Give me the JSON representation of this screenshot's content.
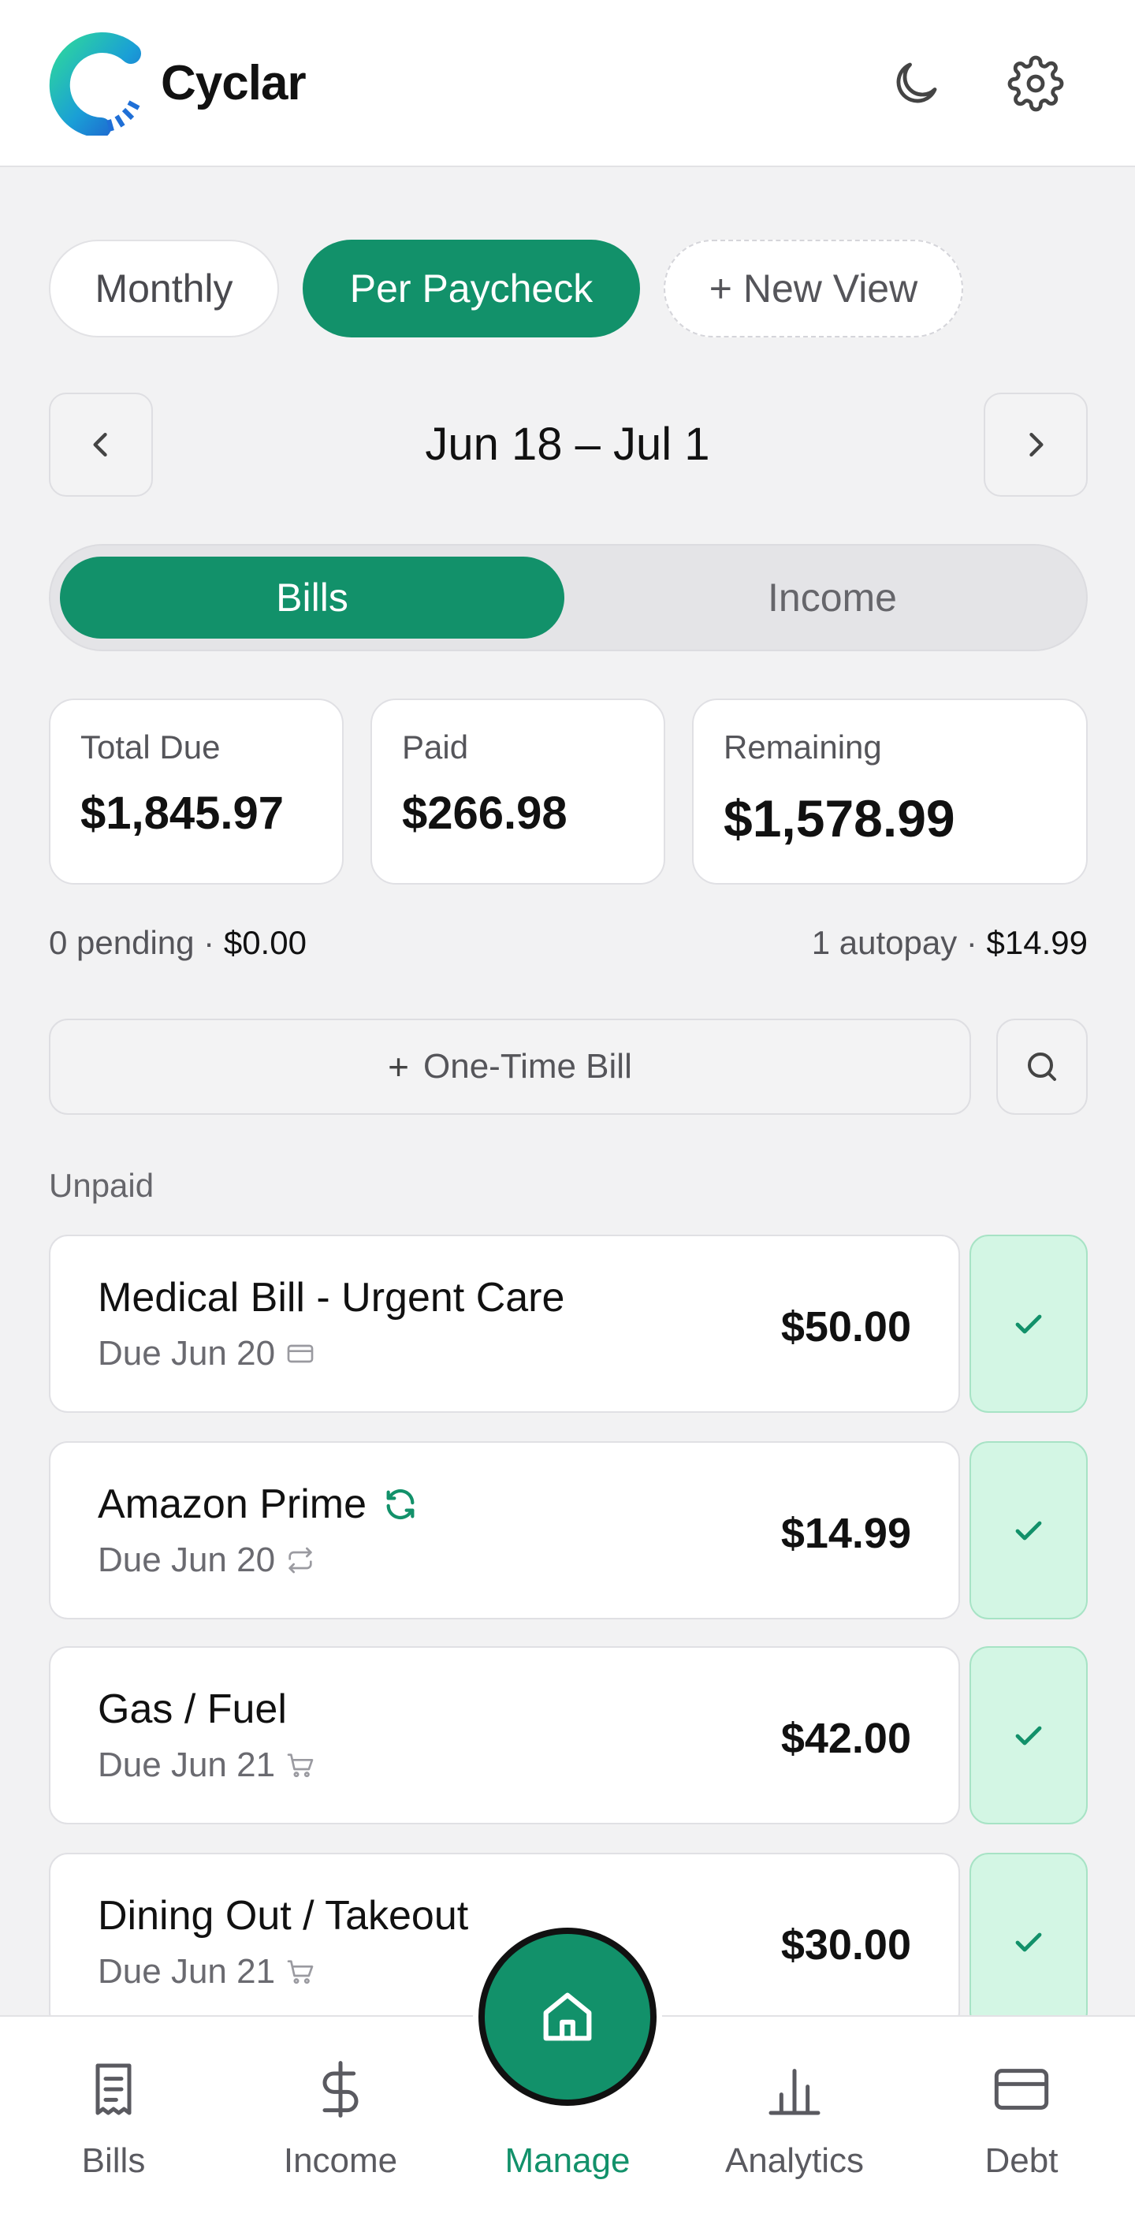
{
  "app": {
    "title": "Cyclar"
  },
  "colors": {
    "accent": "#12916a",
    "check_bg": "#d3f6e4",
    "background": "#f2f2f3"
  },
  "header": {
    "icons": [
      "moon-icon",
      "gear-icon"
    ]
  },
  "views": {
    "monthly": "Monthly",
    "per_paycheck": "Per Paycheck",
    "new_view": "+ New View",
    "selected": "Per Paycheck"
  },
  "period": {
    "range": "Jun 18 – Jul 1"
  },
  "segment": {
    "bills": "Bills",
    "income": "Income",
    "selected": "Bills"
  },
  "stats": {
    "total_due": {
      "label": "Total Due",
      "value": "$1,845.97"
    },
    "paid": {
      "label": "Paid",
      "value": "$266.98"
    },
    "remaining": {
      "label": "Remaining",
      "value": "$1,578.99"
    }
  },
  "summary": {
    "pending_text": "0 pending · ",
    "pending_amount": "$0.00",
    "autopay_text": "1 autopay · ",
    "autopay_amount": "$14.99"
  },
  "actions": {
    "plus": "+",
    "one_time_bill": "One-Time Bill"
  },
  "section": {
    "unpaid": "Unpaid"
  },
  "bills": [
    {
      "name": "Medical Bill - Urgent Care",
      "due": "Due Jun 20",
      "amount": "$50.00",
      "icon": "credit-card-icon"
    },
    {
      "name": "Amazon Prime",
      "due": "Due Jun 20",
      "amount": "$14.99",
      "icon": "repeat-icon",
      "autopay": true
    },
    {
      "name": "Gas / Fuel",
      "due": "Due Jun 21",
      "amount": "$42.00",
      "icon": "cart-icon"
    },
    {
      "name": "Dining Out / Takeout",
      "due": "Due Jun 21",
      "amount": "$30.00",
      "icon": "cart-icon"
    }
  ],
  "tabs": {
    "bills": "Bills",
    "income": "Income",
    "manage": "Manage",
    "analytics": "Analytics",
    "debt": "Debt",
    "active": "Manage"
  }
}
